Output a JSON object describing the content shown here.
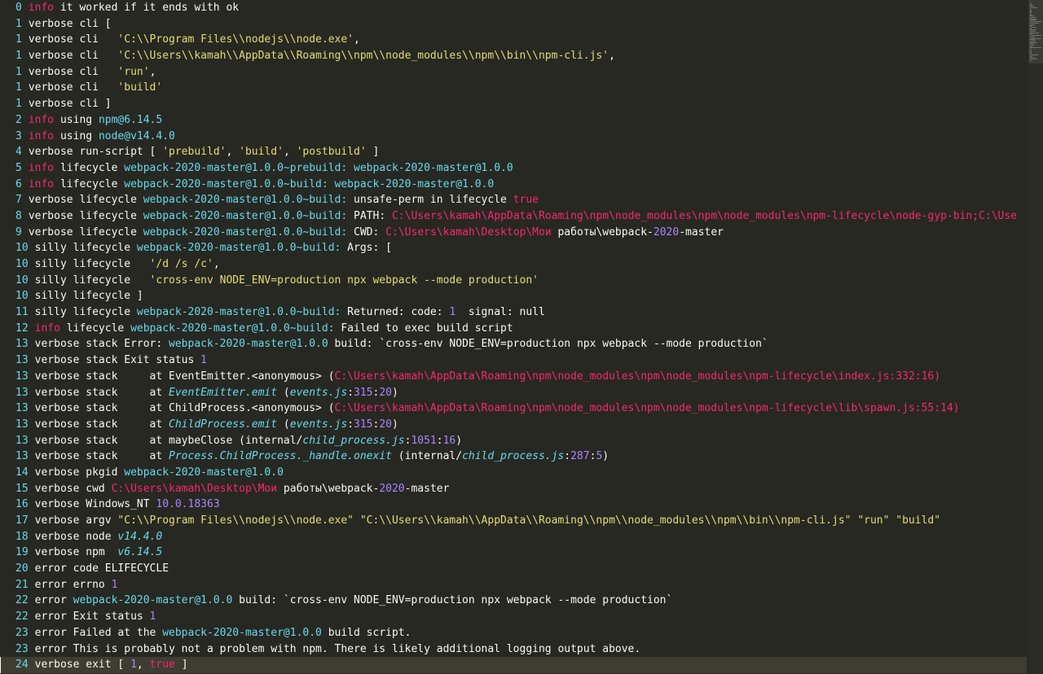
{
  "editor": {
    "current_line_index": 41,
    "lines": [
      {
        "n": "0",
        "level": "info",
        "segs": [
          [
            "it worked if it ends with ok",
            "t-plain"
          ]
        ]
      },
      {
        "n": "1",
        "level": "verbose",
        "segs": [
          [
            "cli [",
            "t-plain"
          ]
        ]
      },
      {
        "n": "1",
        "level": "verbose",
        "segs": [
          [
            "cli   ",
            "t-plain"
          ],
          [
            "'C:\\\\Program Files\\\\nodejs\\\\node.exe'",
            "t-str"
          ],
          [
            ",",
            "t-plain"
          ]
        ]
      },
      {
        "n": "1",
        "level": "verbose",
        "segs": [
          [
            "cli   ",
            "t-plain"
          ],
          [
            "'C:\\\\Users\\\\kamah\\\\AppData\\\\Roaming\\\\npm\\\\node_modules\\\\npm\\\\bin\\\\npm-cli.js'",
            "t-str"
          ],
          [
            ",",
            "t-plain"
          ]
        ]
      },
      {
        "n": "1",
        "level": "verbose",
        "segs": [
          [
            "cli   ",
            "t-plain"
          ],
          [
            "'run'",
            "t-str"
          ],
          [
            ",",
            "t-plain"
          ]
        ]
      },
      {
        "n": "1",
        "level": "verbose",
        "segs": [
          [
            "cli   ",
            "t-plain"
          ],
          [
            "'build'",
            "t-str"
          ]
        ]
      },
      {
        "n": "1",
        "level": "verbose",
        "segs": [
          [
            "cli ]",
            "t-plain"
          ]
        ]
      },
      {
        "n": "2",
        "level": "info",
        "segs": [
          [
            "using ",
            "t-plain"
          ],
          [
            "npm@6.14.5",
            "t-pkg"
          ]
        ]
      },
      {
        "n": "3",
        "level": "info",
        "segs": [
          [
            "using ",
            "t-plain"
          ],
          [
            "node@v14.4.0",
            "t-pkg"
          ]
        ]
      },
      {
        "n": "4",
        "level": "verbose",
        "segs": [
          [
            "run-script [ ",
            "t-plain"
          ],
          [
            "'prebuild'",
            "t-str"
          ],
          [
            ", ",
            "t-plain"
          ],
          [
            "'build'",
            "t-str"
          ],
          [
            ", ",
            "t-plain"
          ],
          [
            "'postbuild'",
            "t-str"
          ],
          [
            " ]",
            "t-plain"
          ]
        ]
      },
      {
        "n": "5",
        "level": "info",
        "segs": [
          [
            "lifecycle ",
            "t-plain"
          ],
          [
            "webpack-2020-master@1.0.0~prebuild: webpack-2020-master@1.0.0",
            "t-pkg"
          ]
        ]
      },
      {
        "n": "6",
        "level": "info",
        "segs": [
          [
            "lifecycle ",
            "t-plain"
          ],
          [
            "webpack-2020-master@1.0.0~build: webpack-2020-master@1.0.0",
            "t-pkg"
          ]
        ]
      },
      {
        "n": "7",
        "level": "verbose",
        "segs": [
          [
            "lifecycle ",
            "t-plain"
          ],
          [
            "webpack-2020-master@1.0.0~build:",
            "t-pkg"
          ],
          [
            " unsafe-perm in lifecycle ",
            "t-plain"
          ],
          [
            "true",
            "t-kw"
          ]
        ]
      },
      {
        "n": "8",
        "level": "verbose",
        "segs": [
          [
            "lifecycle ",
            "t-plain"
          ],
          [
            "webpack-2020-master@1.0.0~build:",
            "t-pkg"
          ],
          [
            " PATH: ",
            "t-plain"
          ],
          [
            "C:\\Users\\kamah\\AppData\\Roaming\\npm\\node_modules\\npm\\node_modules\\npm-lifecycle\\node-gyp-bin;C:\\Use",
            "t-path"
          ]
        ]
      },
      {
        "n": "9",
        "level": "verbose",
        "segs": [
          [
            "lifecycle ",
            "t-plain"
          ],
          [
            "webpack-2020-master@1.0.0~build:",
            "t-pkg"
          ],
          [
            " CWD: ",
            "t-plain"
          ],
          [
            "C:\\Users\\kamah\\Desktop\\Мои",
            "t-path"
          ],
          [
            " работы\\webpack-",
            "t-plain"
          ],
          [
            "2020",
            "t-num"
          ],
          [
            "-master",
            "t-plain"
          ]
        ]
      },
      {
        "n": "10",
        "level": "silly",
        "segs": [
          [
            "lifecycle ",
            "t-plain"
          ],
          [
            "webpack-2020-master@1.0.0~build:",
            "t-pkg"
          ],
          [
            " Args: [",
            "t-plain"
          ]
        ]
      },
      {
        "n": "10",
        "level": "silly",
        "segs": [
          [
            "lifecycle   ",
            "t-plain"
          ],
          [
            "'/d /s /c'",
            "t-str"
          ],
          [
            ",",
            "t-plain"
          ]
        ]
      },
      {
        "n": "10",
        "level": "silly",
        "segs": [
          [
            "lifecycle   ",
            "t-plain"
          ],
          [
            "'cross-env NODE_ENV=production npx webpack --mode production'",
            "t-str"
          ]
        ]
      },
      {
        "n": "10",
        "level": "silly",
        "segs": [
          [
            "lifecycle ]",
            "t-plain"
          ]
        ]
      },
      {
        "n": "11",
        "level": "silly",
        "segs": [
          [
            "lifecycle ",
            "t-plain"
          ],
          [
            "webpack-2020-master@1.0.0~build:",
            "t-pkg"
          ],
          [
            " Returned: code: ",
            "t-plain"
          ],
          [
            "1",
            "t-num"
          ],
          [
            "  signal: null",
            "t-plain"
          ]
        ]
      },
      {
        "n": "12",
        "level": "info",
        "segs": [
          [
            "lifecycle ",
            "t-plain"
          ],
          [
            "webpack-2020-master@1.0.0~build:",
            "t-pkg"
          ],
          [
            " Failed to exec build script",
            "t-plain"
          ]
        ]
      },
      {
        "n": "13",
        "level": "verbose",
        "segs": [
          [
            "stack Error: ",
            "t-plain"
          ],
          [
            "webpack-2020-master@1.0.0",
            "t-pkg"
          ],
          [
            " build: `cross-env NODE_ENV=production npx webpack --mode production`",
            "t-plain"
          ]
        ]
      },
      {
        "n": "13",
        "level": "verbose",
        "segs": [
          [
            "stack Exit status ",
            "t-plain"
          ],
          [
            "1",
            "t-num"
          ]
        ]
      },
      {
        "n": "13",
        "level": "verbose",
        "segs": [
          [
            "stack     at EventEmitter.<anonymous> (",
            "t-plain"
          ],
          [
            "C:\\Users\\kamah\\AppData\\Roaming\\npm\\node_modules\\npm\\node_modules\\npm-lifecycle\\index.js:332:16)",
            "t-path"
          ]
        ]
      },
      {
        "n": "13",
        "level": "verbose",
        "segs": [
          [
            "stack     at ",
            "t-plain"
          ],
          [
            "EventEmitter.emit",
            "t-ital"
          ],
          [
            " (",
            "t-plain"
          ],
          [
            "events.js",
            "t-ital"
          ],
          [
            ":",
            "t-plain"
          ],
          [
            "315",
            "t-num"
          ],
          [
            ":",
            "t-plain"
          ],
          [
            "20",
            "t-num"
          ],
          [
            ")",
            "t-plain"
          ]
        ]
      },
      {
        "n": "13",
        "level": "verbose",
        "segs": [
          [
            "stack     at ChildProcess.<anonymous> (",
            "t-plain"
          ],
          [
            "C:\\Users\\kamah\\AppData\\Roaming\\npm\\node_modules\\npm\\node_modules\\npm-lifecycle\\lib\\spawn.js:55:14)",
            "t-path"
          ]
        ]
      },
      {
        "n": "13",
        "level": "verbose",
        "segs": [
          [
            "stack     at ",
            "t-plain"
          ],
          [
            "ChildProcess.emit",
            "t-ital"
          ],
          [
            " (",
            "t-plain"
          ],
          [
            "events.js",
            "t-ital"
          ],
          [
            ":",
            "t-plain"
          ],
          [
            "315",
            "t-num"
          ],
          [
            ":",
            "t-plain"
          ],
          [
            "20",
            "t-num"
          ],
          [
            ")",
            "t-plain"
          ]
        ]
      },
      {
        "n": "13",
        "level": "verbose",
        "segs": [
          [
            "stack     at maybeClose (internal/",
            "t-plain"
          ],
          [
            "child_process.js",
            "t-ital"
          ],
          [
            ":",
            "t-plain"
          ],
          [
            "1051",
            "t-num"
          ],
          [
            ":",
            "t-plain"
          ],
          [
            "16",
            "t-num"
          ],
          [
            ")",
            "t-plain"
          ]
        ]
      },
      {
        "n": "13",
        "level": "verbose",
        "segs": [
          [
            "stack     at ",
            "t-plain"
          ],
          [
            "Process.ChildProcess._handle.onexit",
            "t-ital"
          ],
          [
            " (internal/",
            "t-plain"
          ],
          [
            "child_process.js",
            "t-ital"
          ],
          [
            ":",
            "t-plain"
          ],
          [
            "287",
            "t-num"
          ],
          [
            ":",
            "t-plain"
          ],
          [
            "5",
            "t-num"
          ],
          [
            ")",
            "t-plain"
          ]
        ]
      },
      {
        "n": "14",
        "level": "verbose",
        "segs": [
          [
            "pkgid ",
            "t-plain"
          ],
          [
            "webpack-2020-master@1.0.0",
            "t-pkg"
          ]
        ]
      },
      {
        "n": "15",
        "level": "verbose",
        "segs": [
          [
            "cwd ",
            "t-plain"
          ],
          [
            "C:\\Users\\kamah\\Desktop\\Мои",
            "t-path"
          ],
          [
            " работы\\webpack-",
            "t-plain"
          ],
          [
            "2020",
            "t-num"
          ],
          [
            "-master",
            "t-plain"
          ]
        ]
      },
      {
        "n": "16",
        "level": "verbose",
        "segs": [
          [
            "Windows_NT ",
            "t-plain"
          ],
          [
            "10.0.18363",
            "t-num"
          ]
        ]
      },
      {
        "n": "17",
        "level": "verbose",
        "segs": [
          [
            "argv ",
            "t-plain"
          ],
          [
            "\"C:\\\\Program Files\\\\nodejs\\\\node.exe\" \"C:\\\\Users\\\\kamah\\\\AppData\\\\Roaming\\\\npm\\\\node_modules\\\\npm\\\\bin\\\\npm-cli.js\" \"run\" \"build\"",
            "t-str"
          ]
        ]
      },
      {
        "n": "18",
        "level": "verbose",
        "segs": [
          [
            "node ",
            "t-plain"
          ],
          [
            "v14.4.0",
            "t-ital"
          ]
        ]
      },
      {
        "n": "19",
        "level": "verbose",
        "segs": [
          [
            "npm  ",
            "t-plain"
          ],
          [
            "v6.14.5",
            "t-ital"
          ]
        ]
      },
      {
        "n": "20",
        "level": "error",
        "segs": [
          [
            "code ELIFECYCLE",
            "t-plain"
          ]
        ]
      },
      {
        "n": "21",
        "level": "error",
        "segs": [
          [
            "errno ",
            "t-plain"
          ],
          [
            "1",
            "t-num"
          ]
        ]
      },
      {
        "n": "22",
        "level": "error",
        "segs": [
          [
            "webpack-2020-master@1.0.0",
            "t-pkg"
          ],
          [
            " build: `cross-env NODE_ENV=production npx webpack --mode production`",
            "t-plain"
          ]
        ]
      },
      {
        "n": "22",
        "level": "error",
        "segs": [
          [
            "Exit status ",
            "t-plain"
          ],
          [
            "1",
            "t-num"
          ]
        ]
      },
      {
        "n": "23",
        "level": "error",
        "segs": [
          [
            "Failed at the ",
            "t-plain"
          ],
          [
            "webpack-2020-master@1.0.0",
            "t-pkg"
          ],
          [
            " build script.",
            "t-plain"
          ]
        ]
      },
      {
        "n": "23",
        "level": "error",
        "segs": [
          [
            "This is probably not a problem with npm. There is likely additional logging output above.",
            "t-plain"
          ]
        ]
      },
      {
        "n": "24",
        "level": "verbose",
        "segs": [
          [
            "exit [ ",
            "t-plain"
          ],
          [
            "1",
            "t-num"
          ],
          [
            ", ",
            "t-plain"
          ],
          [
            "true",
            "t-kw"
          ],
          [
            " ]",
            "t-plain"
          ]
        ]
      }
    ]
  },
  "colors": {
    "background": "#272822",
    "line_number": "#66d9ef",
    "info_level": "#f92672",
    "string": "#e6db74",
    "package": "#66d9ef",
    "path": "#f92672",
    "number": "#ae81ff"
  }
}
